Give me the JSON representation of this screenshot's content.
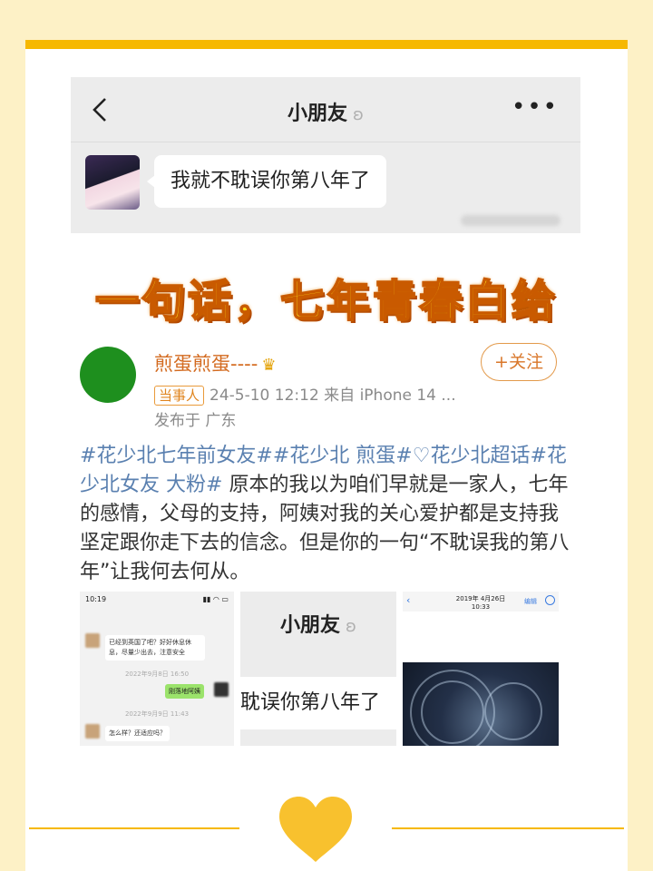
{
  "chat": {
    "title": "小朋友",
    "message": "我就不耽误你第八年了"
  },
  "headline": "一句话，七年青春白给",
  "post": {
    "username": "煎蛋煎蛋----",
    "badge": "当事人",
    "meta": "24-5-10 12:12  来自 iPhone 14 ...",
    "location": "发布于 广东",
    "follow_label": "+关注",
    "tags": "#花少北七年前女友##花少北 煎蛋#♡花少北超话#花少北女友 大粉#",
    "body": "原本的我以为咱们早就是一家人，七年的感情，父母的支持，阿姨对我的关心爱护都是支持我坚定跟你走下去的信念。但是你的一句“不耽误我的第八年”让我何去何从。"
  },
  "thumb1": {
    "status_time": "10:19",
    "msg1": "已经到英国了吧？好好休息休息，尽量少出去，注意安全",
    "time1": "2022年9月8日 16:50",
    "reply": "刚落地阿姨",
    "time2": "2022年9月9日 11:43",
    "msg2": "怎么样？还适应吗？"
  },
  "thumb2": {
    "title": "小朋友",
    "message": "耽误你第八年了"
  },
  "thumb3": {
    "date": "2019年 4月26日",
    "time": "10:33",
    "edit": "编辑"
  },
  "colors": {
    "accent": "#f6b800",
    "tag": "#5a80b0",
    "username": "#d36a1f"
  }
}
